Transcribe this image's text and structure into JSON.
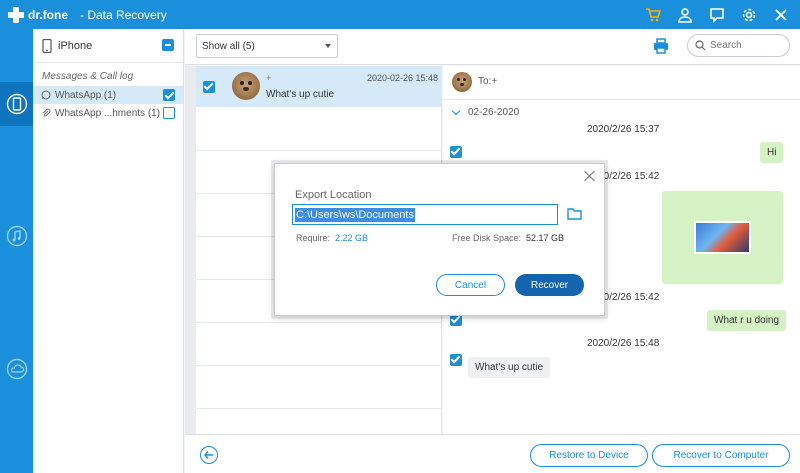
{
  "titlebar": {
    "logo": "dr.fone",
    "title": "- Data Recovery"
  },
  "device": {
    "name": "iPhone"
  },
  "categories": {
    "group_label": "Messages & Call log",
    "items": [
      {
        "label": "WhatsApp (1)",
        "checked": true,
        "selected": true,
        "icon": "whatsapp-icon"
      },
      {
        "label": "WhatsApp ...hments (1)",
        "checked": false,
        "selected": false,
        "icon": "attachment-icon"
      }
    ]
  },
  "toolbar": {
    "filter_value": "Show all (5)",
    "search_placeholder": "Search"
  },
  "conversation": {
    "number": "+",
    "time": "2020-02-26 15:48",
    "preview": "What's up cutie"
  },
  "chat": {
    "to": "To:+",
    "date_group": "02-26-2020",
    "messages": [
      {
        "timestamp": "2020/2/26 15:37",
        "text": "Hi",
        "side": "right"
      },
      {
        "timestamp": "2020/2/26 15:42",
        "text": "",
        "side": "right",
        "image": true
      },
      {
        "timestamp": "2020/2/26 15:42",
        "text": "What r u doing",
        "side": "right"
      },
      {
        "timestamp": "2020/2/26 15:48",
        "text": "What's up cutie",
        "side": "left"
      }
    ]
  },
  "modal": {
    "title": "Export Location",
    "path": "C:\\Users\\ws\\Documents",
    "require_label": "Require:",
    "require_value": "2.22 GB",
    "free_label": "Free Disk Space:",
    "free_value": "52.17 GB",
    "cancel": "Cancel",
    "recover": "Recover"
  },
  "bottom": {
    "restore": "Restore to Device",
    "recover_computer": "Recover to Computer"
  },
  "colors": {
    "accent": "#1a8fdc",
    "bubble_out": "#d4f2c4",
    "selection": "#d5e9f9",
    "primary_button": "#1464b0"
  }
}
